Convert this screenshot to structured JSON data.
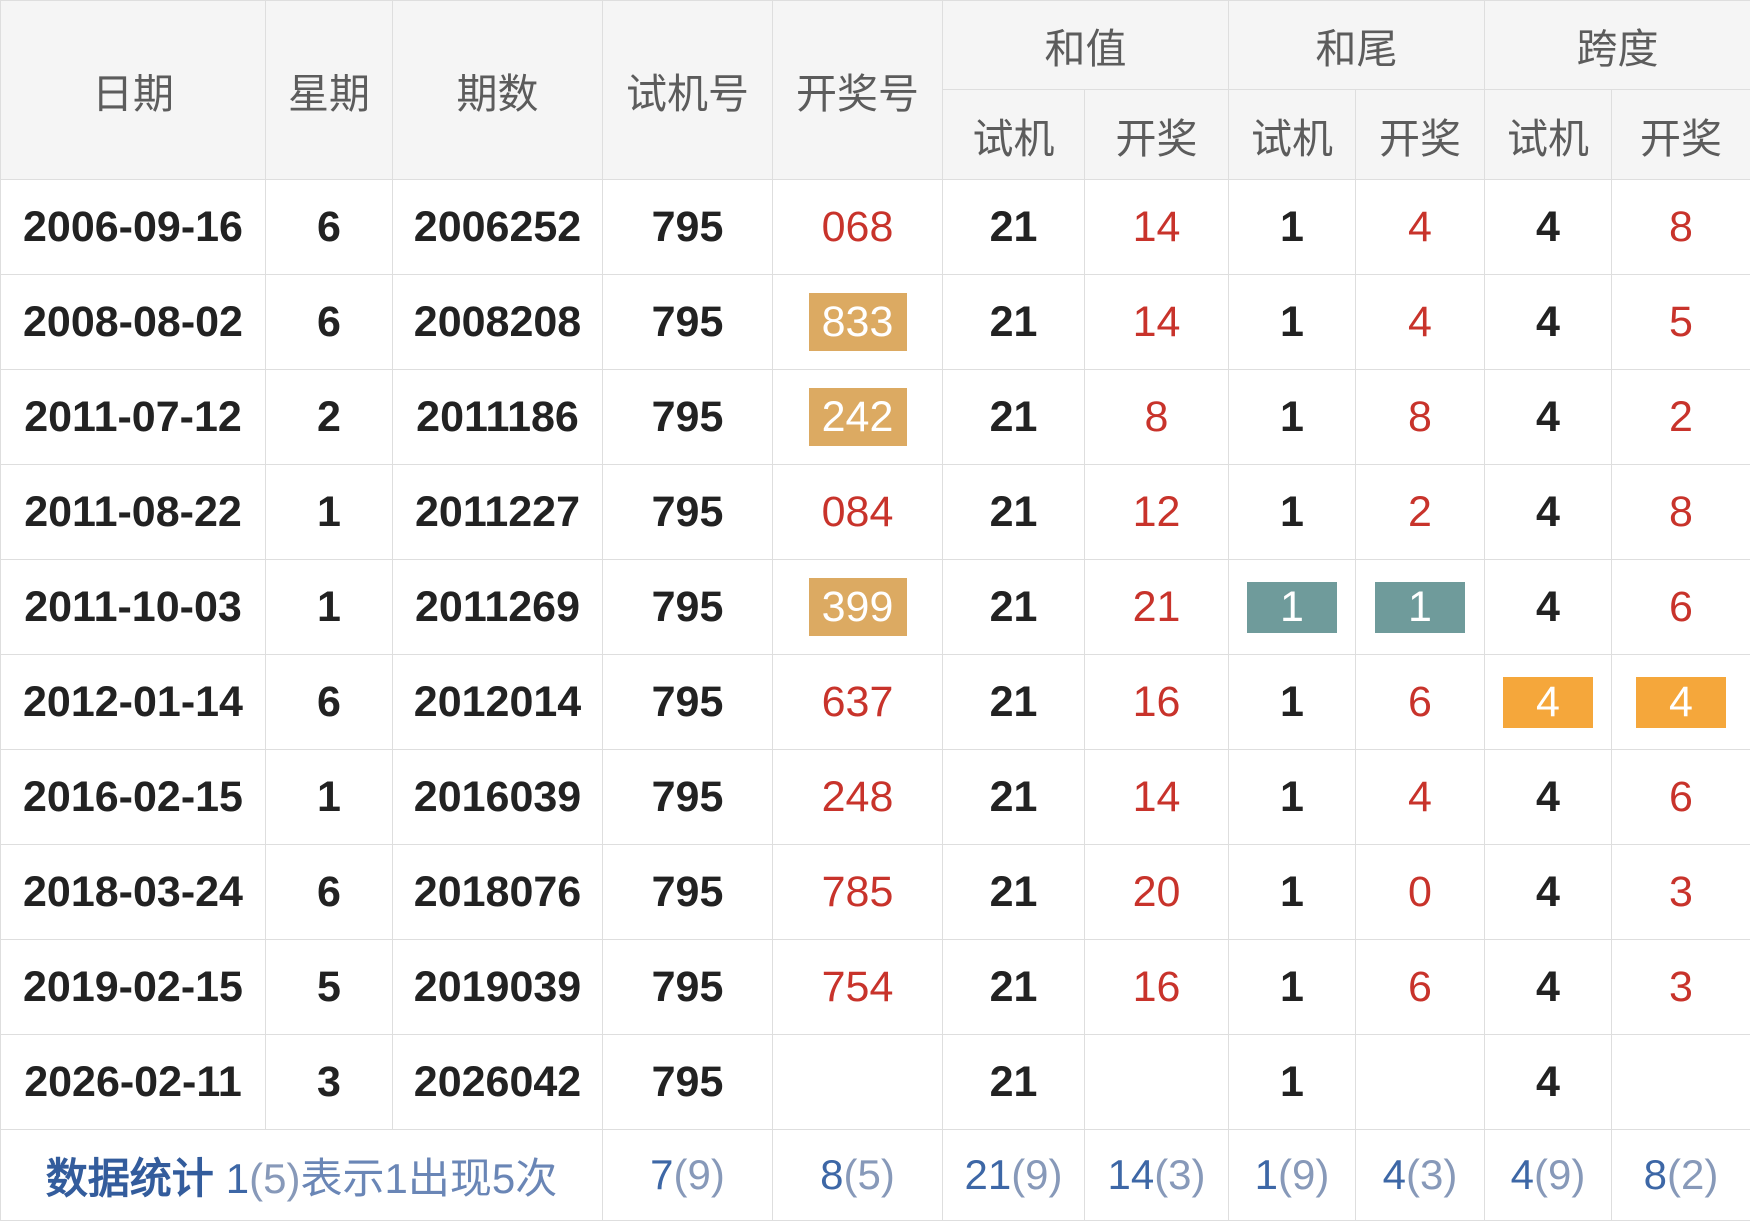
{
  "table": {
    "headers": {
      "date": "日期",
      "weekday": "星期",
      "issue": "期数",
      "trial_number": "试机号",
      "draw_number": "开奖号",
      "groups": [
        {
          "label": "和值",
          "sub": [
            "试机",
            "开奖"
          ]
        },
        {
          "label": "和尾",
          "sub": [
            "试机",
            "开奖"
          ]
        },
        {
          "label": "跨度",
          "sub": [
            "试机",
            "开奖"
          ]
        }
      ]
    },
    "rows": [
      {
        "date": "2006-09-16",
        "weekday": "6",
        "issue": "2006252",
        "trial": "795",
        "draw": "068",
        "sum_trial": "21",
        "sum_draw": "14",
        "tail_trial": "1",
        "tail_draw": "4",
        "span_trial": "4",
        "span_draw": "8"
      },
      {
        "date": "2008-08-02",
        "weekday": "6",
        "issue": "2008208",
        "trial": "795",
        "draw": "833",
        "sum_trial": "21",
        "sum_draw": "14",
        "tail_trial": "1",
        "tail_draw": "4",
        "span_trial": "4",
        "span_draw": "5",
        "marks": {
          "draw": "#dcaa62"
        }
      },
      {
        "date": "2011-07-12",
        "weekday": "2",
        "issue": "2011186",
        "trial": "795",
        "draw": "242",
        "sum_trial": "21",
        "sum_draw": "8",
        "tail_trial": "1",
        "tail_draw": "8",
        "span_trial": "4",
        "span_draw": "2",
        "marks": {
          "draw": "#dcaa62"
        }
      },
      {
        "date": "2011-08-22",
        "weekday": "1",
        "issue": "2011227",
        "trial": "795",
        "draw": "084",
        "sum_trial": "21",
        "sum_draw": "12",
        "tail_trial": "1",
        "tail_draw": "2",
        "span_trial": "4",
        "span_draw": "8"
      },
      {
        "date": "2011-10-03",
        "weekday": "1",
        "issue": "2011269",
        "trial": "795",
        "draw": "399",
        "sum_trial": "21",
        "sum_draw": "21",
        "tail_trial": "1",
        "tail_draw": "1",
        "span_trial": "4",
        "span_draw": "6",
        "marks": {
          "draw": "#dcaa62",
          "tail_trial": "#6f9b9b",
          "tail_draw": "#6f9b9b"
        }
      },
      {
        "date": "2012-01-14",
        "weekday": "6",
        "issue": "2012014",
        "trial": "795",
        "draw": "637",
        "sum_trial": "21",
        "sum_draw": "16",
        "tail_trial": "1",
        "tail_draw": "6",
        "span_trial": "4",
        "span_draw": "4",
        "marks": {
          "span_trial": "#f5a73b",
          "span_draw": "#f5a73b"
        }
      },
      {
        "date": "2016-02-15",
        "weekday": "1",
        "issue": "2016039",
        "trial": "795",
        "draw": "248",
        "sum_trial": "21",
        "sum_draw": "14",
        "tail_trial": "1",
        "tail_draw": "4",
        "span_trial": "4",
        "span_draw": "6"
      },
      {
        "date": "2018-03-24",
        "weekday": "6",
        "issue": "2018076",
        "trial": "795",
        "draw": "785",
        "sum_trial": "21",
        "sum_draw": "20",
        "tail_trial": "1",
        "tail_draw": "0",
        "span_trial": "4",
        "span_draw": "3"
      },
      {
        "date": "2019-02-15",
        "weekday": "5",
        "issue": "2019039",
        "trial": "795",
        "draw": "754",
        "sum_trial": "21",
        "sum_draw": "16",
        "tail_trial": "1",
        "tail_draw": "6",
        "span_trial": "4",
        "span_draw": "3"
      },
      {
        "date": "2026-02-11",
        "weekday": "3",
        "issue": "2026042",
        "trial": "795",
        "sum_trial": "21",
        "tail_trial": "1",
        "span_trial": "4"
      }
    ],
    "footer": {
      "label": "数据统计",
      "legend": {
        "value": "1",
        "count": "(5)",
        "text": "表示1出现5次"
      },
      "stats": [
        {
          "value": "7",
          "count": "(9)"
        },
        {
          "value": "8",
          "count": "(5)"
        },
        {
          "value": "21",
          "count": "(9)"
        },
        {
          "value": "14",
          "count": "(3)"
        },
        {
          "value": "1",
          "count": "(9)"
        },
        {
          "value": "4",
          "count": "(3)"
        },
        {
          "value": "4",
          "count": "(9)"
        },
        {
          "value": "8",
          "count": "(2)"
        }
      ]
    }
  },
  "colors": {
    "text": "#222222",
    "red": "#c8332b",
    "header_bg": "#f5f5f5",
    "header_text": "#5c5c5c",
    "border": "#dedede",
    "blue": "#3d67a6",
    "blue_dark": "#335c9c",
    "blue_mid": "#6a86b6",
    "blue_light": "#8799b9"
  }
}
